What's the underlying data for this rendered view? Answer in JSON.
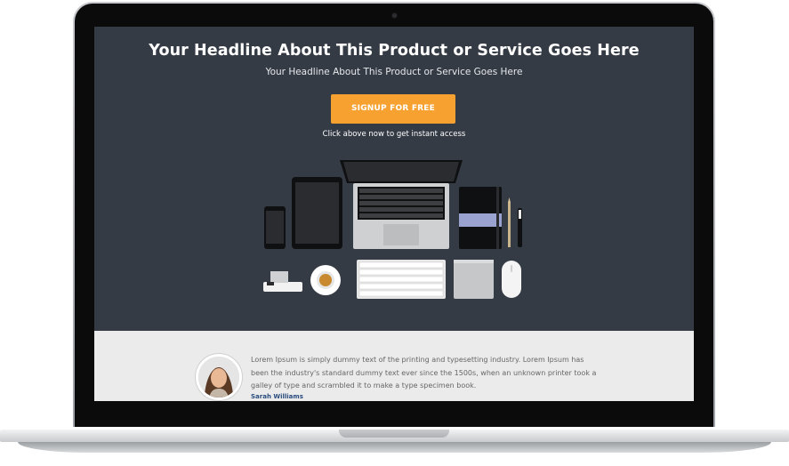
{
  "hero": {
    "headline": "Your Headline About This Product or Service Goes Here",
    "subheadline": "Your Headline About This Product or Service Goes Here",
    "cta_label": "SIGNUP FOR FREE",
    "cta_note": "Click above now to get instant access"
  },
  "testimonial": {
    "quote": "Lorem Ipsum is simply dummy text of the printing and typesetting industry. Lorem Ipsum has been the industry's standard dummy text ever since the 1500s, when an unknown printer took a galley of type and scrambled it to make a type specimen book.",
    "author": "Sarah Williams"
  },
  "colors": {
    "hero_bg": "#353b45",
    "cta": "#f6a130",
    "testimonial_bg": "#ebebeb",
    "author": "#2b4c7e"
  },
  "icons": [
    "laptop-frame",
    "phone-icon",
    "tablet-icon",
    "laptop-icon",
    "notebook-icon",
    "pencil-icon",
    "pen-icon",
    "router-icon",
    "coffee-cup-icon",
    "keyboard-icon",
    "trackpad-icon",
    "mouse-icon",
    "avatar"
  ]
}
